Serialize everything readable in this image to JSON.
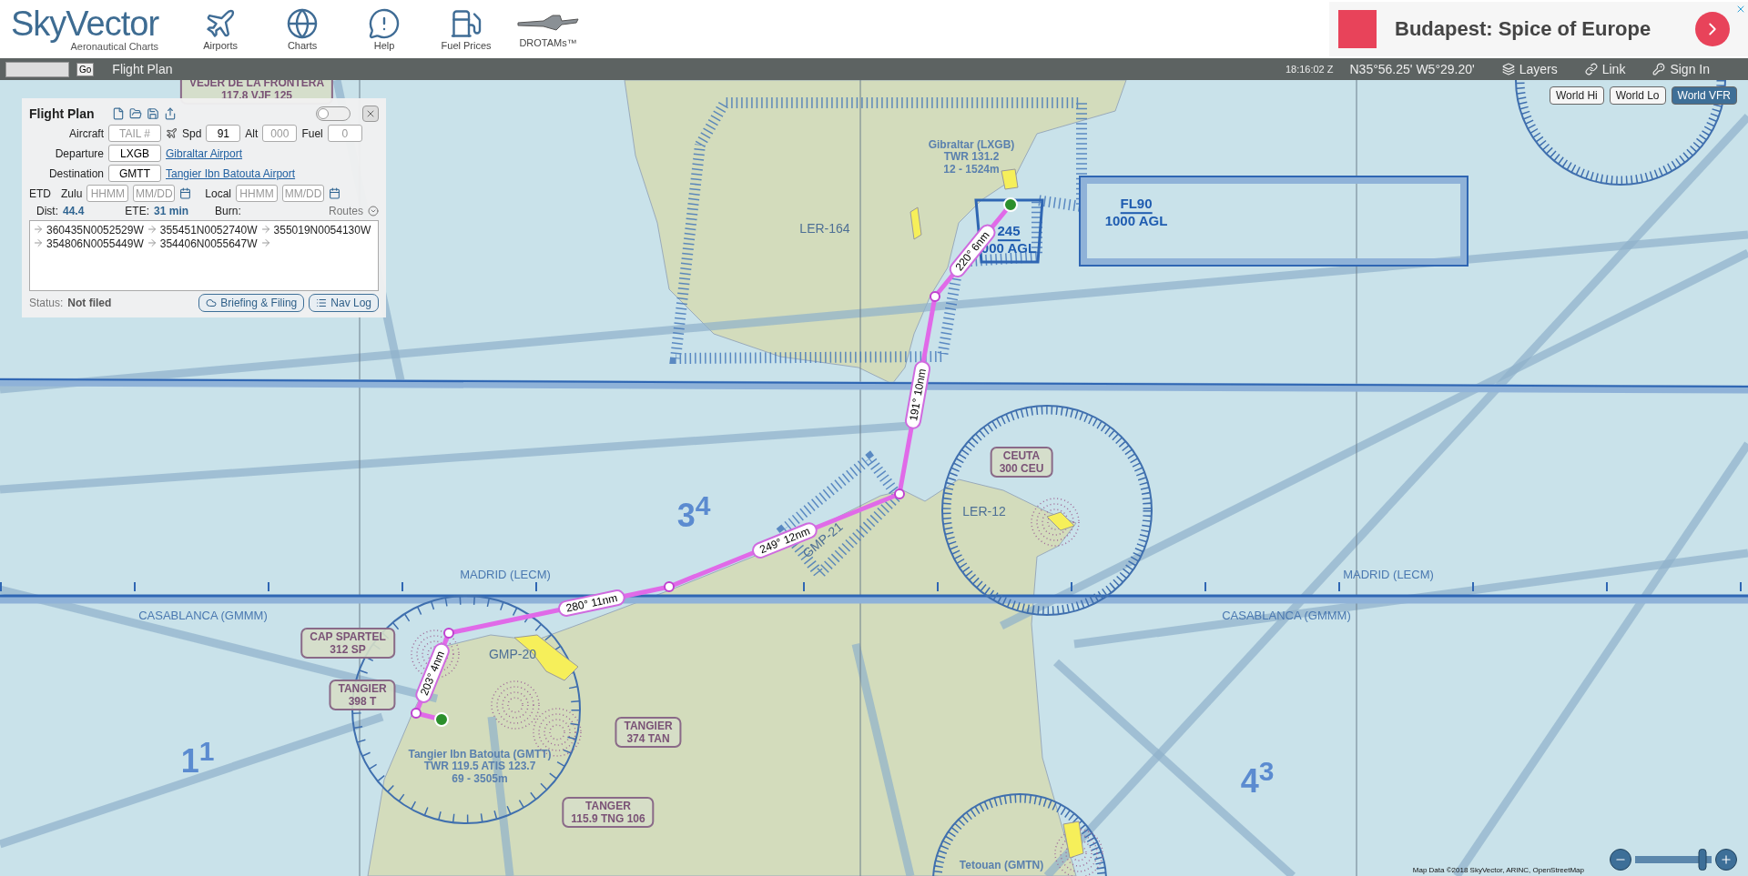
{
  "header": {
    "logo": "SkyVector",
    "tagline": "Aeronautical Charts",
    "nav": [
      {
        "kind": "airports",
        "label": "Airports"
      },
      {
        "kind": "charts",
        "label": "Charts"
      },
      {
        "kind": "help",
        "label": "Help"
      },
      {
        "kind": "fuel",
        "label": "Fuel Prices"
      },
      {
        "kind": "drotams",
        "label": "DROTAMs™"
      }
    ],
    "ad": {
      "title": "Budapest: Spice of Europe"
    }
  },
  "toolbar": {
    "go": "Go",
    "flight_plan": "Flight Plan",
    "time": "18:16:02 Z",
    "position": "N35°56.25' W5°29.20'",
    "links": [
      {
        "kind": "layers",
        "label": "Layers"
      },
      {
        "kind": "link",
        "label": "Link"
      },
      {
        "kind": "signin",
        "label": "Sign In"
      }
    ]
  },
  "flight_plan": {
    "title": "Flight Plan",
    "toggle_on": false,
    "aircraft": {
      "label": "Aircraft",
      "placeholder": "TAIL #"
    },
    "speed": {
      "label": "Spd",
      "value": "91"
    },
    "altitude": {
      "label": "Alt",
      "placeholder": "000"
    },
    "fuel": {
      "label": "Fuel",
      "placeholder": "0"
    },
    "departure": {
      "label": "Departure",
      "value": "LXGB",
      "link": "Gibraltar Airport"
    },
    "destination": {
      "label": "Destination",
      "value": "GMTT",
      "link": "Tangier Ibn Batouta Airport"
    },
    "etd": {
      "label": "ETD",
      "zulu": {
        "label": "Zulu",
        "time": {
          "placeholder": "HHMM"
        },
        "date": {
          "placeholder": "MM/DD"
        }
      },
      "local": {
        "label": "Local",
        "time": {
          "placeholder": "HHMM"
        },
        "date": {
          "placeholder": "MM/DD"
        }
      }
    },
    "stats": [
      {
        "label": "Dist:",
        "value": "44.4"
      },
      {
        "label": "ETE:",
        "value": "31 min"
      },
      {
        "label": "Burn:"
      }
    ],
    "routes": "Routes",
    "waypoints": [
      "360435N0052529W",
      "355451N0052740W",
      "355019N0054130W",
      "354806N0055449W",
      "354406N0055647W"
    ],
    "status": {
      "label": "Status:",
      "value": "Not filed"
    },
    "buttons": [
      {
        "kind": "briefing",
        "label": "Briefing & Filing"
      },
      {
        "kind": "navlog",
        "label": "Nav Log"
      }
    ]
  },
  "map": {
    "layer_buttons": [
      {
        "label": "World Hi",
        "selected": false
      },
      {
        "label": "World Lo",
        "selected": false
      },
      {
        "label": "World VFR",
        "selected": true
      }
    ],
    "labels": [
      {
        "kind": "navaid",
        "lines": [
          "VEJER DE LA FRONTERA",
          "117.8 VJF 125"
        ]
      },
      {
        "kind": "airport",
        "lines": [
          "Gibraltar (LXGB)",
          "TWR 131.2",
          "12 - 1524m"
        ]
      },
      {
        "kind": "airspace",
        "lines": [
          "LER-164"
        ]
      },
      {
        "kind": "altitude",
        "lines": [
          "FL90",
          "1000 AGL"
        ]
      },
      {
        "kind": "altitude",
        "lines": [
          "245",
          "000 AGL"
        ]
      },
      {
        "kind": "quadrant",
        "lines": [
          "3$^{4}$"
        ]
      },
      {
        "kind": "region",
        "lines": [
          "MADRID (LECM)"
        ]
      },
      {
        "kind": "region",
        "lines": [
          "MADRID (LECM)"
        ]
      },
      {
        "kind": "region",
        "lines": [
          "CASABLANCA (GMMM)"
        ]
      },
      {
        "kind": "region",
        "lines": [
          "CASABLANCA (GMMM)"
        ]
      },
      {
        "kind": "airspace",
        "lines": [
          "GMP-21"
        ]
      },
      {
        "kind": "airspace",
        "lines": [
          "LER-12"
        ]
      },
      {
        "kind": "navaid",
        "lines": [
          "CEUTA",
          "300 CEU"
        ]
      },
      {
        "kind": "airspace",
        "lines": [
          "GMP-20"
        ]
      },
      {
        "kind": "navaid",
        "lines": [
          "CAP SPARTEL",
          "312 SP"
        ]
      },
      {
        "kind": "navaid",
        "lines": [
          "TANGIER",
          "398 T"
        ]
      },
      {
        "kind": "navaid",
        "lines": [
          "TANGIER",
          "374 TAN"
        ]
      },
      {
        "kind": "airport",
        "lines": [
          "Tangier Ibn Batouta (GMTT)",
          "TWR 119.5 ATIS 123.7",
          "69 - 3505m"
        ]
      },
      {
        "kind": "navaid",
        "lines": [
          "TANGER",
          "115.9 TNG 106"
        ]
      },
      {
        "kind": "quadrant",
        "lines": [
          "1$^{1}$"
        ]
      },
      {
        "kind": "quadrant",
        "lines": [
          "4$^{3}$"
        ]
      },
      {
        "kind": "airport",
        "lines": [
          "Tetouan (GMTN)"
        ]
      }
    ],
    "legs": [
      {
        "label": "220° 6nm"
      },
      {
        "label": "191° 10nm"
      },
      {
        "label": "249° 12nm"
      },
      {
        "label": "280° 11nm"
      },
      {
        "label": "203° 4nm"
      }
    ],
    "zoom": {
      "level": 0.88
    },
    "attribution": "Map Data ©2018 SkyVector, ARINC, OpenStreetMap"
  }
}
